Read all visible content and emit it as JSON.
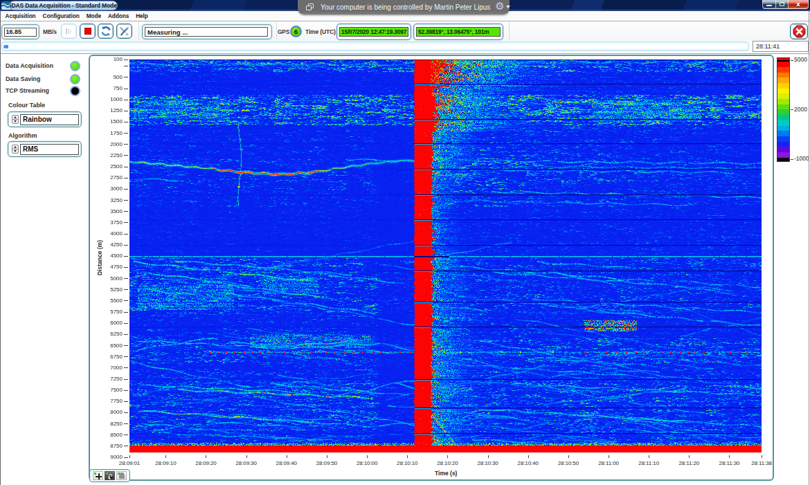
{
  "window": {
    "title": "iDAS Data Acquisition - Standard Mode",
    "caption_buttons": [
      "minimize",
      "maximize",
      "close"
    ]
  },
  "remote_banner": {
    "text": "Your computer is being controlled by Martin Peter Lipus",
    "icons": [
      "window-copy-icon",
      "gear-icon",
      "caret-down-icon"
    ]
  },
  "menu": {
    "items": [
      "Acquisition",
      "Configuration",
      "Mode",
      "Addons",
      "Help"
    ]
  },
  "toolbar": {
    "rate_value": "16.85",
    "rate_unit": "MB/s",
    "buttons": [
      {
        "name": "record",
        "state": "disabled"
      },
      {
        "name": "stop",
        "state": "enabled"
      },
      {
        "name": "refresh",
        "state": "enabled"
      },
      {
        "name": "settings",
        "state": "enabled"
      }
    ],
    "status_value": "Measuring ...",
    "gps_label": "GPS",
    "gps_satellites": "6",
    "time_label": "Time (UTC)",
    "time_value": "15/07/2020 12:47:19.3097",
    "position_value": "52.39819°, 13.06475°, 101m",
    "abort_button": "stop-sign"
  },
  "timeline": {
    "elapsed": "28:11:41"
  },
  "sidebar": {
    "indicators": [
      {
        "label": "Data Acquisition",
        "color": "#4fdd12",
        "state": "on"
      },
      {
        "label": "Data Saving",
        "color": "#4fdd12",
        "state": "on"
      },
      {
        "label": "TCP Streaming",
        "color": "#000000",
        "state": "off"
      }
    ],
    "colour_table": {
      "label": "Colour Table",
      "value": "Rainbow"
    },
    "algorithm": {
      "label": "Algorithm",
      "value": "RMS"
    }
  },
  "chart_data": {
    "type": "heatmap",
    "xlabel": "Time (s)",
    "ylabel": "Distance (m)",
    "x_range_seconds": 157,
    "x_ticks": [
      {
        "t": 0,
        "label": "28:09:01"
      },
      {
        "t": 9,
        "label": "28:09:10"
      },
      {
        "t": 19,
        "label": "28:09:20"
      },
      {
        "t": 29,
        "label": "28:09:30"
      },
      {
        "t": 39,
        "label": "28:09:40"
      },
      {
        "t": 49,
        "label": "28:09:50"
      },
      {
        "t": 59,
        "label": "28:10:00"
      },
      {
        "t": 69,
        "label": "28:10:10"
      },
      {
        "t": 79,
        "label": "28:10:20"
      },
      {
        "t": 89,
        "label": "28:10:30"
      },
      {
        "t": 99,
        "label": "28:10:40"
      },
      {
        "t": 109,
        "label": "28:10:50"
      },
      {
        "t": 119,
        "label": "28:11:00"
      },
      {
        "t": 129,
        "label": "28:11:10"
      },
      {
        "t": 139,
        "label": "28:11:20"
      },
      {
        "t": 149,
        "label": "28:11:30"
      },
      {
        "t": 157,
        "label": "28:11:38"
      }
    ],
    "y_axis": {
      "min": 100,
      "max": 9000,
      "tick_step": 250,
      "first_tick": 100,
      "unlabeled": [
        250
      ]
    },
    "data_depth_max": 8890,
    "color_scale": {
      "ticks": [
        {
          "v": 5000,
          "label": "5000"
        },
        {
          "v": 2000,
          "label": "2000"
        },
        {
          "v": -1000,
          "label": "-1000"
        }
      ],
      "palette_name": "Rainbow",
      "segments": [
        "#e80000",
        "#000000",
        "#ff0000",
        "#ff3c00",
        "#ff7800",
        "#ffaa00",
        "#ffd200",
        "#fff000",
        "#d8f000",
        "#a0e800",
        "#62dc0a",
        "#28d03c",
        "#00c88c",
        "#00c8c8",
        "#00aae6",
        "#0078f0",
        "#0046f5",
        "#1e1ef0",
        "#5a0ae6",
        "#8c14dc",
        "#000000"
      ]
    },
    "features": {
      "seed": 20200715,
      "burst_column": {
        "t0": 70.8,
        "t1": 74.6,
        "note": "saturated event column at 28:10:12"
      },
      "bottom_band": {
        "d0": 8736,
        "d1": 8890
      },
      "bottom_band_speckle_edge": {
        "d0": 8680,
        "d1": 8736
      },
      "full_width_line": {
        "d": 4495
      },
      "dotted_line": {
        "d": 6640,
        "segments": [
          {
            "t0": 20,
            "t1": 70.5,
            "density": 0.6,
            "amp": 1.0
          },
          {
            "t0": 76,
            "t1": 112,
            "density": 0.18,
            "amp": 0.75
          },
          {
            "t0": 113,
            "t1": 155,
            "density": 0.42,
            "amp": 1.0
          }
        ]
      },
      "gap_rows": [
        640,
        1430,
        1970,
        2540,
        3110,
        3680,
        4250,
        4820,
        5510,
        6075,
        7250,
        7890,
        8460
      ],
      "gap_row_on_line": 4495,
      "wavy_line": {
        "points": [
          [
            0,
            2380
          ],
          [
            6,
            2420
          ],
          [
            12,
            2470
          ],
          [
            20,
            2535
          ],
          [
            28,
            2615
          ],
          [
            37,
            2665
          ],
          [
            44,
            2630
          ],
          [
            50,
            2555
          ],
          [
            56,
            2470
          ],
          [
            62,
            2400
          ],
          [
            67,
            2360
          ],
          [
            70.8,
            2350
          ]
        ],
        "amp_profile": [
          [
            0,
            0.45
          ],
          [
            3,
            0.72
          ],
          [
            19,
            0.65
          ],
          [
            22,
            0.92
          ],
          [
            26,
            1.0
          ],
          [
            45,
            1.0
          ],
          [
            50,
            0.75
          ],
          [
            56,
            0.6
          ],
          [
            62,
            0.55
          ],
          [
            70.8,
            0.5
          ]
        ]
      },
      "vertical_wiggle": {
        "t": 27.3,
        "d0": 1500,
        "d1": 3350,
        "red_dots": [
          1880,
          2110,
          2640,
          2940
        ]
      },
      "echo_lines": [
        {
          "t0": 0,
          "d0": 2760,
          "t1": 12,
          "d1": 2790,
          "amp": 0.25
        },
        {
          "t0": 54,
          "d0": 2330,
          "t1": 70,
          "d1": 2355,
          "amp": 0.3
        },
        {
          "t0": 0,
          "d0": 200,
          "t1": 70,
          "d1": 205,
          "amp": 0.28
        },
        {
          "t0": 76,
          "d0": 150,
          "t1": 157,
          "d1": 160,
          "amp": 0.3
        }
      ],
      "top_red_dot": {
        "t": 128.7,
        "d": 150
      },
      "noise_bands": [
        {
          "d0": 100,
          "d1": 390,
          "left": 0.62,
          "right": 0.62
        },
        {
          "d0": 390,
          "d1": 900,
          "left": 0.1,
          "right": 0.3,
          "decay": 1
        },
        {
          "d0": 900,
          "d1": 1580,
          "left": 0.88,
          "right": 0.88
        },
        {
          "d0": 1580,
          "d1": 2320,
          "left": 0.16,
          "right": 0.5,
          "decay": 1
        },
        {
          "d0": 2320,
          "d1": 2900,
          "left": 0.26,
          "right": 0.65,
          "decay": 1
        },
        {
          "d0": 2900,
          "d1": 3400,
          "left": 0.2,
          "right": 0.5,
          "decay": 1
        },
        {
          "d0": 3400,
          "d1": 4450,
          "left": 0.09,
          "right": 0.16
        },
        {
          "d0": 4550,
          "d1": 5780,
          "left": 0.42,
          "right": 0.3
        },
        {
          "d0": 5780,
          "d1": 6350,
          "left": 0.2,
          "right": 0.34,
          "decay": 1
        },
        {
          "d0": 6350,
          "d1": 6900,
          "left": 0.4,
          "right": 0.42
        },
        {
          "d0": 6900,
          "d1": 7260,
          "left": 0.24,
          "right": 0.26
        },
        {
          "d0": 7260,
          "d1": 7700,
          "left": 0.4,
          "right": 0.46
        },
        {
          "d0": 7700,
          "d1": 8400,
          "left": 0.42,
          "right": 0.42
        },
        {
          "d0": 8400,
          "d1": 8680,
          "left": 0.3,
          "right": 0.38
        }
      ],
      "patches": [
        {
          "t0": 2,
          "t1": 26,
          "d0": 5150,
          "d1": 5700,
          "g": 0.5
        },
        {
          "t0": 33,
          "t1": 47,
          "d0": 4950,
          "d1": 5350,
          "g": 0.45
        },
        {
          "t0": 113,
          "t1": 126,
          "d0": 5930,
          "d1": 6180,
          "g": 1.0,
          "red": 1,
          "dense": 1
        },
        {
          "t0": 30,
          "t1": 60,
          "d0": 6250,
          "d1": 6550,
          "g": 0.5,
          "red": 1
        },
        {
          "t0": 1,
          "t1": 25,
          "d0": 1000,
          "d1": 1450,
          "g": 0.5
        },
        {
          "t0": 115,
          "t1": 142,
          "d0": 1000,
          "d1": 1500,
          "g": 0.5
        }
      ],
      "streaks": [
        {
          "t0": 1,
          "d0": 4620,
          "t1": 45,
          "d1": 5050,
          "a": 0.5
        },
        {
          "t0": 3,
          "d0": 4850,
          "t1": 30,
          "d1": 5150,
          "a": 0.4
        },
        {
          "t0": 12,
          "d0": 4600,
          "t1": 55,
          "d1": 4900,
          "a": 0.35
        },
        {
          "t0": 0,
          "d0": 5200,
          "t1": 25,
          "d1": 5450,
          "a": 0.35
        },
        {
          "t0": 18,
          "d0": 5050,
          "t1": 48,
          "d1": 5420,
          "a": 0.45
        },
        {
          "t0": 30,
          "d0": 4700,
          "t1": 68,
          "d1": 5100,
          "a": 0.3
        },
        {
          "t0": 2,
          "d0": 6380,
          "t1": 40,
          "d1": 6560,
          "a": 0.4
        },
        {
          "t0": 25,
          "d0": 6420,
          "t1": 66,
          "d1": 6650,
          "a": 0.35
        },
        {
          "t0": 32,
          "d0": 6540,
          "t1": 58,
          "d1": 6380,
          "a": 0.4
        },
        {
          "t0": 38,
          "d0": 6560,
          "t1": 62,
          "d1": 6440,
          "a": 0.38
        },
        {
          "t0": 4,
          "d0": 7380,
          "t1": 40,
          "d1": 7520,
          "a": 0.4
        },
        {
          "t0": 12,
          "d0": 7480,
          "t1": 60,
          "d1": 7660,
          "a": 0.5,
          "red": 1
        },
        {
          "t0": 2,
          "d0": 7950,
          "t1": 45,
          "d1": 8200,
          "a": 0.55,
          "red": 1
        },
        {
          "t0": 20,
          "d0": 8050,
          "t1": 60,
          "d1": 8300,
          "a": 0.4
        },
        {
          "t0": 8,
          "d0": 8450,
          "t1": 50,
          "d1": 8600,
          "a": 0.3
        },
        {
          "t0": 35,
          "d0": 7350,
          "t1": 69,
          "d1": 7600,
          "a": 0.35
        },
        {
          "t0": 0,
          "d0": 6850,
          "t1": 30,
          "d1": 7420,
          "a": 0.35
        },
        {
          "t0": 78,
          "d0": 4700,
          "t1": 130,
          "d1": 5050,
          "a": 0.35
        },
        {
          "t0": 90,
          "d0": 4850,
          "t1": 150,
          "d1": 5250,
          "a": 0.3
        },
        {
          "t0": 100,
          "d0": 5450,
          "t1": 157,
          "d1": 5750,
          "a": 0.3
        },
        {
          "t0": 80,
          "d0": 6900,
          "t1": 130,
          "d1": 7200,
          "a": 0.3
        },
        {
          "t0": 95,
          "d0": 7350,
          "t1": 157,
          "d1": 7600,
          "a": 0.4
        },
        {
          "t0": 85,
          "d0": 7900,
          "t1": 140,
          "d1": 8200,
          "a": 0.4
        },
        {
          "t0": 110,
          "d0": 8050,
          "t1": 157,
          "d1": 8300,
          "a": 0.35
        },
        {
          "t0": 120,
          "d0": 8350,
          "t1": 157,
          "d1": 8560,
          "a": 0.3
        },
        {
          "t0": 90,
          "d0": 3050,
          "t1": 157,
          "d1": 3180,
          "a": 0.3
        },
        {
          "t0": 80,
          "d0": 3250,
          "t1": 140,
          "d1": 3350,
          "a": 0.25
        },
        {
          "t0": 78,
          "d0": 2350,
          "t1": 157,
          "d1": 2420,
          "a": 0.3
        },
        {
          "t0": 95,
          "d0": 2480,
          "t1": 157,
          "d1": 2530,
          "a": 0.28
        },
        {
          "t0": 85,
          "d0": 2560,
          "t1": 150,
          "d1": 2620,
          "a": 0.26
        },
        {
          "t0": 100,
          "d0": 1250,
          "t1": 157,
          "d1": 1300,
          "a": 0.3
        },
        {
          "t0": 92,
          "d0": 1060,
          "t1": 145,
          "d1": 1100,
          "a": 0.28
        }
      ],
      "generic_streaks": {
        "count": 76,
        "d_min": 4550,
        "d_max": 8650,
        "amp_min": 0.16,
        "amp_max": 0.34
      }
    }
  },
  "graph_palette": {
    "tools": [
      "cursor-cross",
      "zoom",
      "pan-hand"
    ]
  }
}
